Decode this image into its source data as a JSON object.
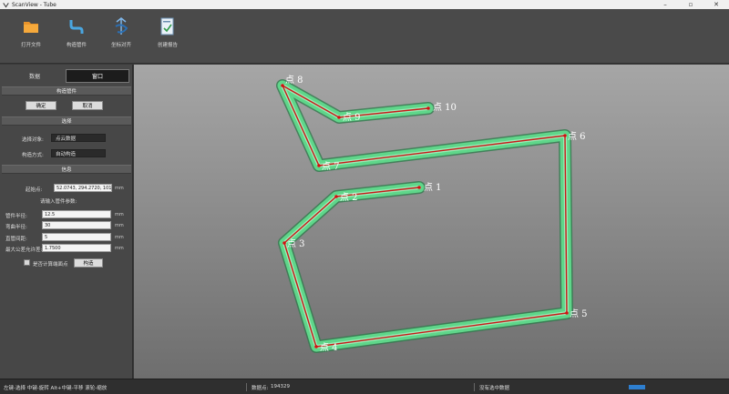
{
  "window": {
    "title": "ScanView - Tube"
  },
  "toolbar": {
    "items": [
      {
        "label": "打开文件",
        "icon": "folder-icon"
      },
      {
        "label": "构造管件",
        "icon": "pipe-icon"
      },
      {
        "label": "坐标对齐",
        "icon": "align-icon"
      },
      {
        "label": "创建报告",
        "icon": "report-icon"
      }
    ]
  },
  "panel": {
    "tabs": [
      {
        "label": "数据"
      },
      {
        "label": "窗口"
      }
    ],
    "sections": {
      "construct": "构造管件",
      "select": "选择",
      "info": "信息"
    },
    "buttons": {
      "ok": "确定",
      "cancel": "取消",
      "build": "构造"
    },
    "select": {
      "object_label": "选择对象:",
      "object_value": "点云数据",
      "mode_label": "构造方式:",
      "mode_value": "自动构造"
    },
    "info": {
      "start_label": "起始点:",
      "start_value": "52.0743, 294.2720, 101.1958",
      "start_unit": "mm",
      "prompt": "请输入管件参数:",
      "params": [
        {
          "label": "管件半径:",
          "value": "12.5",
          "unit": "mm"
        },
        {
          "label": "弯曲半径:",
          "value": "30",
          "unit": "mm"
        },
        {
          "label": "直管间距:",
          "value": "5",
          "unit": "mm"
        },
        {
          "label": "最大公差允许差:",
          "value": "1.7500",
          "unit": "mm"
        }
      ],
      "checkbox_label": "是否计算端面点"
    }
  },
  "viewport": {
    "pipe_color": "#5fd68a",
    "centerline_color": "#c81818",
    "points": [
      {
        "label": "点 1"
      },
      {
        "label": "点 2"
      },
      {
        "label": "点 3"
      },
      {
        "label": "点 4"
      },
      {
        "label": "点 5"
      },
      {
        "label": "点 6"
      },
      {
        "label": "点 7"
      },
      {
        "label": "点 8"
      },
      {
        "label": "点 9"
      },
      {
        "label": "点 10"
      }
    ]
  },
  "status": {
    "hint": "左键-选择 中键-旋转 Alt+中键-平移 滚轮-缩放",
    "count_label": "数据点:",
    "count_value": "194329",
    "message": "没有选中数据",
    "progress": 1.0
  }
}
